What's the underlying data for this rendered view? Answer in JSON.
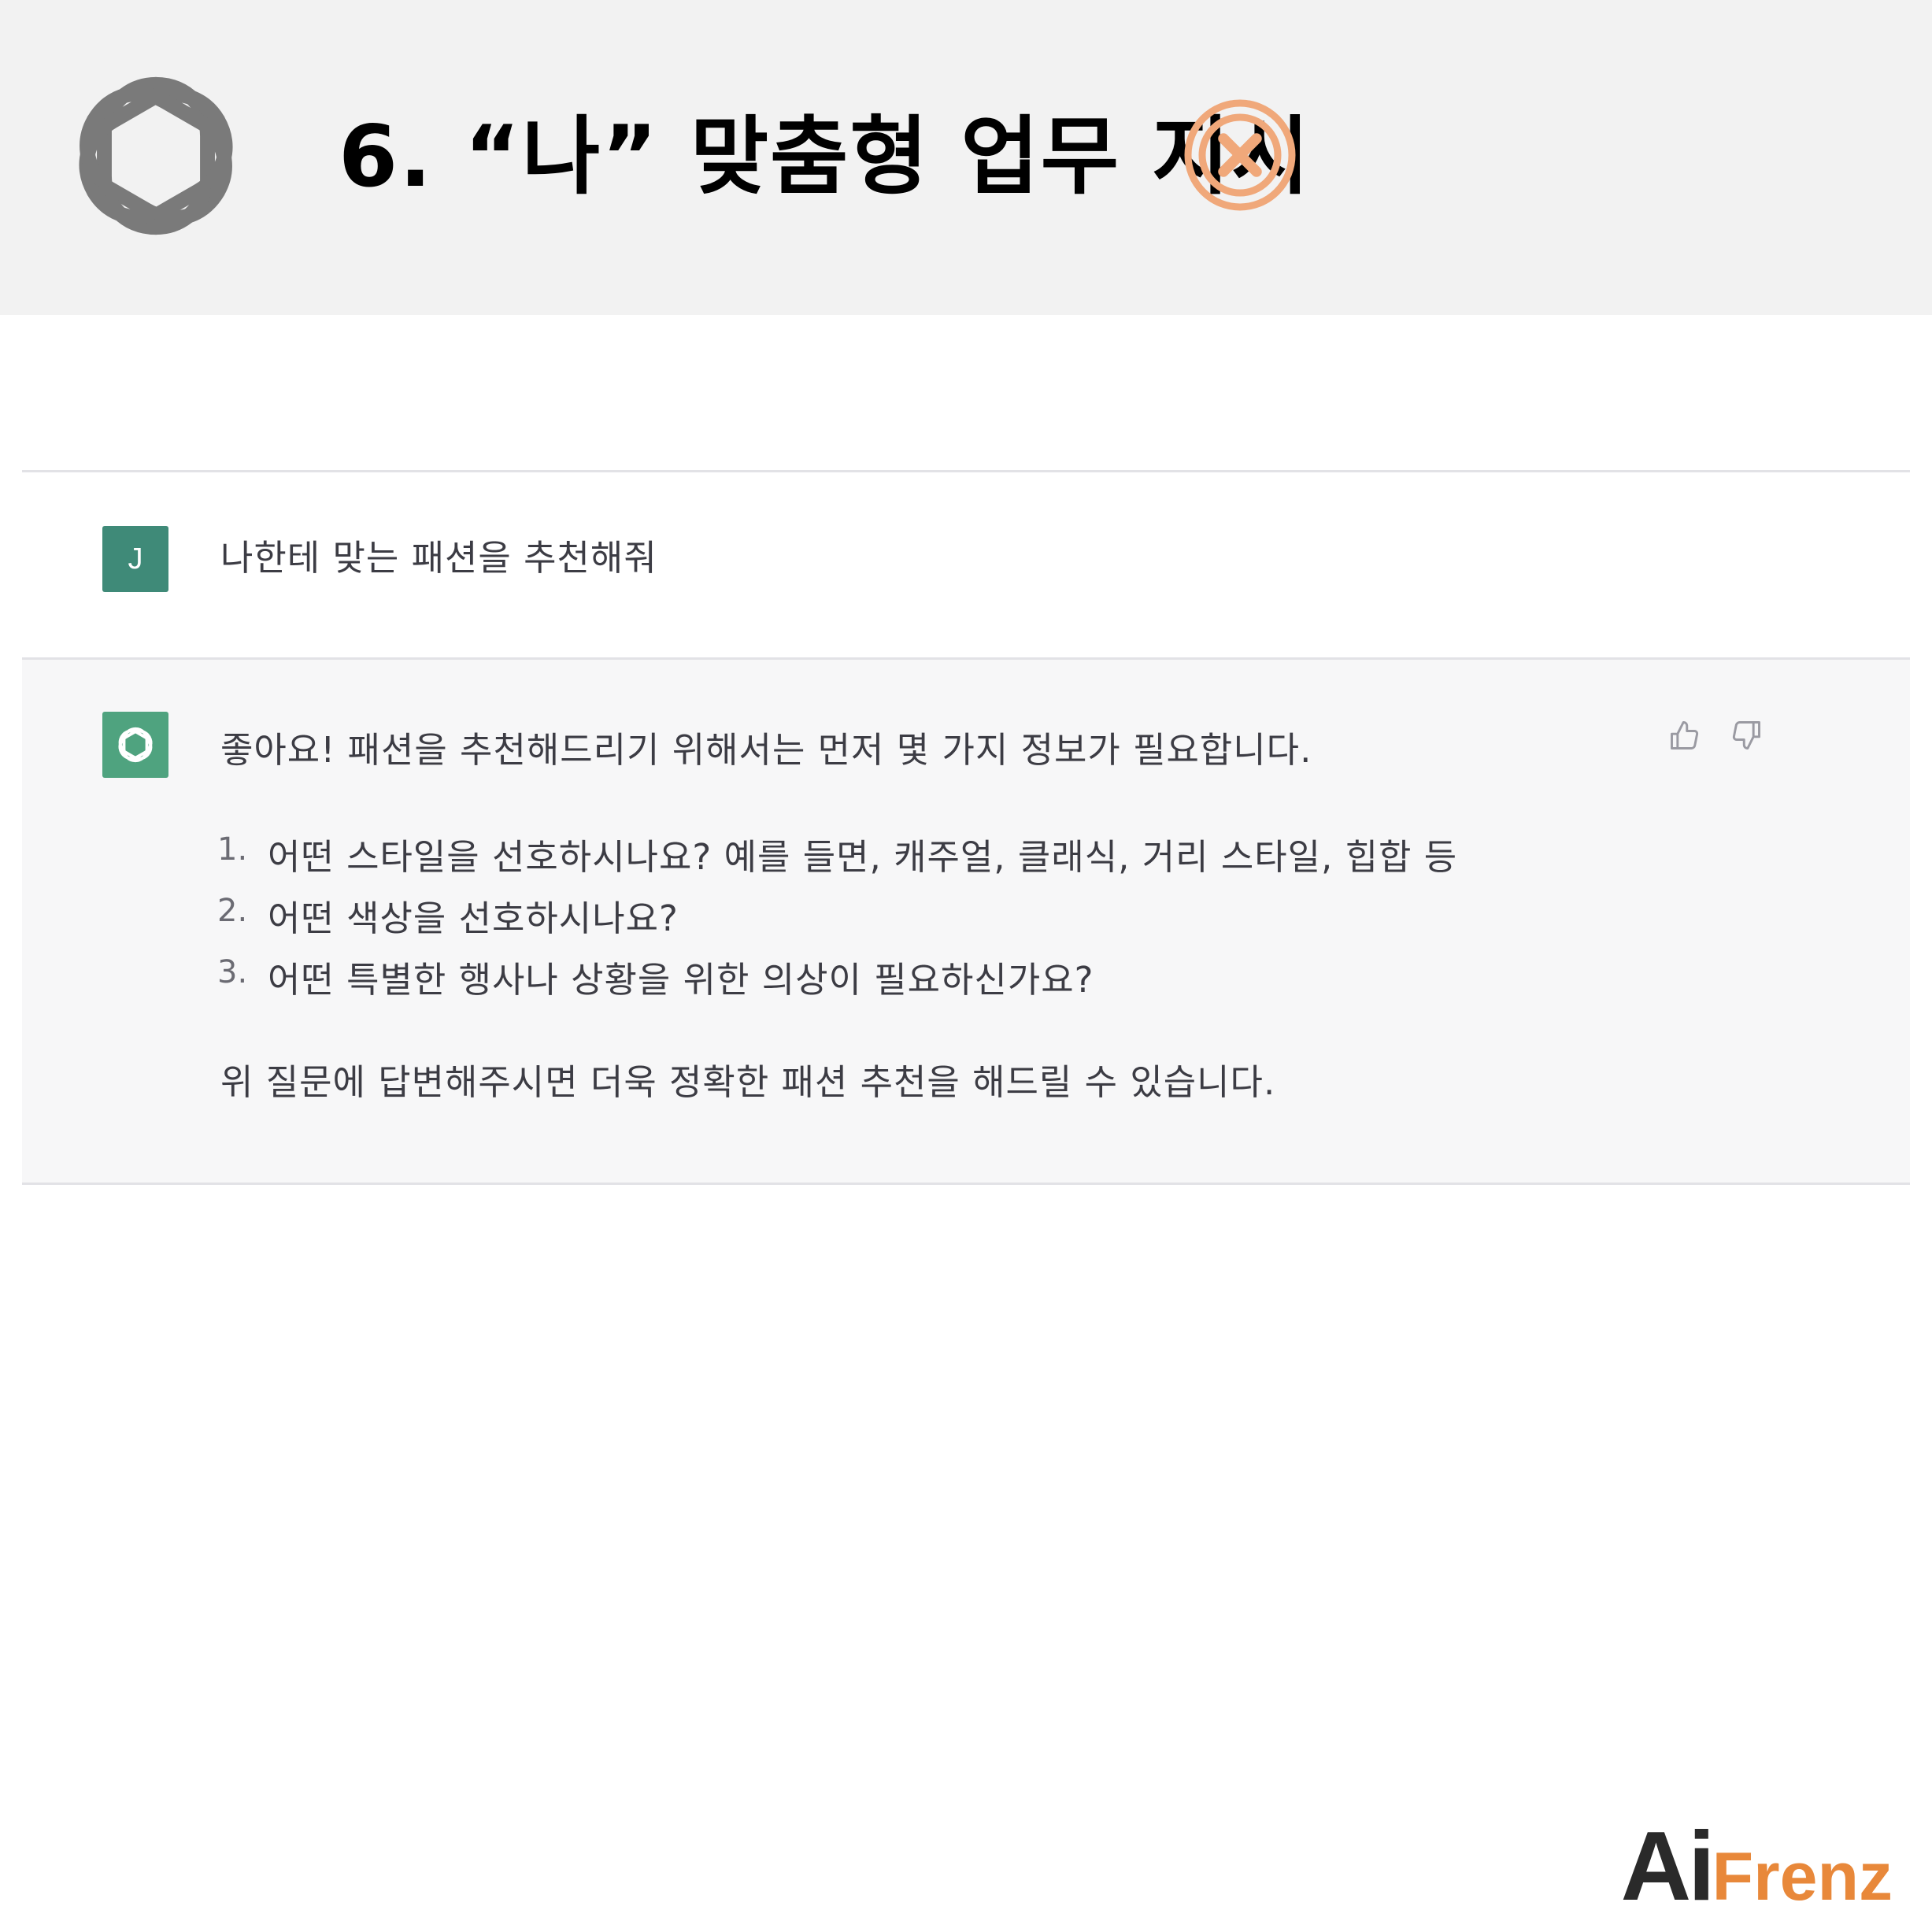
{
  "header": {
    "title": "6. “나” 맞춤형 업무 지시",
    "status_icon": "x-circle-icon",
    "status_color": "#f0a87a",
    "logo_icon": "openai-logo-icon"
  },
  "conversation": {
    "user": {
      "avatar_letter": "J",
      "avatar_color": "#3f8a78",
      "message": "나한테 맞는 패션을 추천해줘"
    },
    "assistant": {
      "avatar_icon": "openai-logo-icon",
      "avatar_color": "#4fa37f",
      "intro": "좋아요! 패션을 추천해드리기 위해서는 먼저 몇 가지 정보가 필요합니다.",
      "questions": [
        {
          "num": "1.",
          "text": "어떤 스타일을 선호하시나요? 예를 들면, 캐주얼, 클래식, 거리 스타일, 힙합 등"
        },
        {
          "num": "2.",
          "text": "어떤 색상을 선호하시나요?"
        },
        {
          "num": "3.",
          "text": "어떤 특별한 행사나 상황을 위한 의상이 필요하신가요?"
        }
      ],
      "closing": "위 질문에 답변해주시면 더욱 정확한 패션 추천을 해드릴 수 있습니다.",
      "feedback": {
        "like_icon": "thumbs-up-icon",
        "dislike_icon": "thumbs-down-icon"
      }
    }
  },
  "brand": {
    "part1": "Ai",
    "part2": "Frenz",
    "accent": "#e8883a"
  }
}
